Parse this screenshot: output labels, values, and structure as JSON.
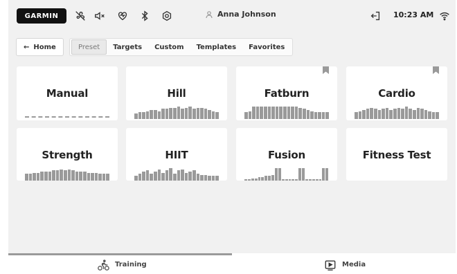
{
  "status_bar": {
    "brand": "GARMIN",
    "icons": [
      "fan-off-icon",
      "volume-off-icon",
      "heart-rate-icon",
      "bluetooth-icon",
      "ant-plus-icon"
    ],
    "user_name": "Anna Johnson",
    "time": "10:23 AM",
    "right_icons": [
      "logout-icon",
      "wifi-icon"
    ]
  },
  "nav": {
    "home_label": "Home",
    "tabs": [
      {
        "label": "Preset",
        "active": true
      },
      {
        "label": "Targets",
        "active": false
      },
      {
        "label": "Custom",
        "active": false
      },
      {
        "label": "Templates",
        "active": false
      },
      {
        "label": "Favorites",
        "active": false
      }
    ]
  },
  "cards": [
    {
      "title": "Manual",
      "bookmarked": false,
      "profile": "flat"
    },
    {
      "title": "Hill",
      "bookmarked": false,
      "profile": [
        5,
        6,
        6,
        7,
        8,
        8,
        7,
        9,
        9,
        10,
        10,
        11,
        9,
        10,
        11,
        9,
        10,
        10,
        9,
        8,
        7,
        6
      ]
    },
    {
      "title": "Fatburn",
      "bookmarked": true,
      "profile": [
        6,
        7,
        11,
        11,
        11,
        11,
        11,
        11,
        11,
        11,
        11,
        11,
        11,
        11,
        10,
        9,
        8,
        7,
        6,
        6,
        6,
        6
      ]
    },
    {
      "title": "Cardio",
      "bookmarked": true,
      "profile": [
        6,
        7,
        8,
        9,
        10,
        9,
        8,
        9,
        10,
        8,
        9,
        10,
        9,
        11,
        9,
        8,
        10,
        9,
        8,
        7,
        6,
        6
      ]
    },
    {
      "title": "Strength",
      "bookmarked": false,
      "profile": [
        6,
        6,
        7,
        7,
        8,
        8,
        8,
        9,
        9,
        10,
        9,
        10,
        9,
        8,
        8,
        8,
        7,
        7,
        7,
        6,
        6,
        6
      ]
    },
    {
      "title": "HIIT",
      "bookmarked": false,
      "profile": [
        4,
        6,
        8,
        9,
        6,
        8,
        10,
        7,
        9,
        11,
        6,
        9,
        10,
        7,
        8,
        9,
        6,
        5,
        5,
        4,
        4,
        4
      ]
    },
    {
      "title": "Fusion",
      "bookmarked": false,
      "profile": [
        1,
        1,
        2,
        2,
        3,
        3,
        4,
        4,
        5,
        11,
        11,
        1,
        1,
        1,
        1,
        1,
        11,
        11,
        1,
        1,
        1,
        1,
        1,
        11,
        11
      ]
    },
    {
      "title": "Fitness Test",
      "bookmarked": false,
      "profile": "none"
    }
  ],
  "bottom_nav": {
    "tabs": [
      {
        "label": "Training",
        "icon": "cyclist-icon",
        "active": true
      },
      {
        "label": "Media",
        "icon": "play-icon",
        "active": false
      }
    ]
  },
  "colors": {
    "background": "#f1f1f1",
    "card": "#ffffff",
    "bar": "#9a9a9a",
    "brand": "#111111"
  }
}
